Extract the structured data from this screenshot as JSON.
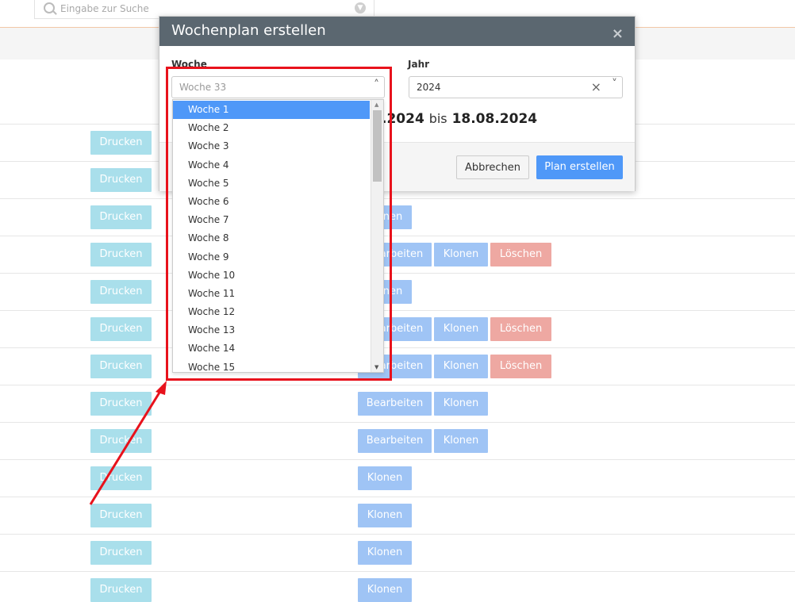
{
  "search": {
    "placeholder": "Eingabe zur Suche",
    "icon": "search-icon",
    "toggle_icon": "chevron-down-circle-icon"
  },
  "rows": [
    {
      "print": "Drucken",
      "actions": []
    },
    {
      "print": "Drucken",
      "actions": []
    },
    {
      "print": "Drucken",
      "actions": [
        "Klonen"
      ]
    },
    {
      "print": "Drucken",
      "actions": [
        "Bearbeiten",
        "Klonen",
        "Löschen"
      ]
    },
    {
      "print": "Drucken",
      "actions": [
        "Klonen"
      ]
    },
    {
      "print": "Drucken",
      "actions": [
        "Bearbeiten",
        "Klonen",
        "Löschen"
      ]
    },
    {
      "print": "Drucken",
      "actions": [
        "Bearbeiten",
        "Klonen",
        "Löschen"
      ]
    },
    {
      "print": "Drucken",
      "actions": [
        "Bearbeiten",
        "Klonen"
      ]
    },
    {
      "print": "Drucken",
      "actions": [
        "Bearbeiten",
        "Klonen"
      ]
    },
    {
      "print": "Drucken",
      "actions": [
        "Klonen"
      ]
    },
    {
      "print": "Drucken",
      "actions": [
        "Klonen"
      ]
    },
    {
      "print": "Drucken",
      "actions": [
        "Klonen"
      ]
    },
    {
      "print": "Drucken",
      "actions": [
        "Klonen"
      ]
    }
  ],
  "modal": {
    "title": "Wochenplan erstellen",
    "close": "×",
    "week_label": "Woche",
    "week_value": "Woche 33",
    "year_label": "Jahr",
    "year_value": "2024",
    "range_from": ".2024",
    "range_bis": "bis",
    "range_to": "18.08.2024",
    "cancel": "Abbrechen",
    "submit": "Plan erstellen"
  },
  "week_options": [
    "Woche 1",
    "Woche 2",
    "Woche 3",
    "Woche 4",
    "Woche 5",
    "Woche 6",
    "Woche 7",
    "Woche 8",
    "Woche 9",
    "Woche 10",
    "Woche 11",
    "Woche 12",
    "Woche 13",
    "Woche 14",
    "Woche 15"
  ],
  "colors": {
    "header": "#5b6770",
    "primary": "#4f98f8",
    "print": "#a9dfeb",
    "action": "#9fc4f5",
    "delete": "#eea8a2",
    "annotation": "#e8121c"
  }
}
